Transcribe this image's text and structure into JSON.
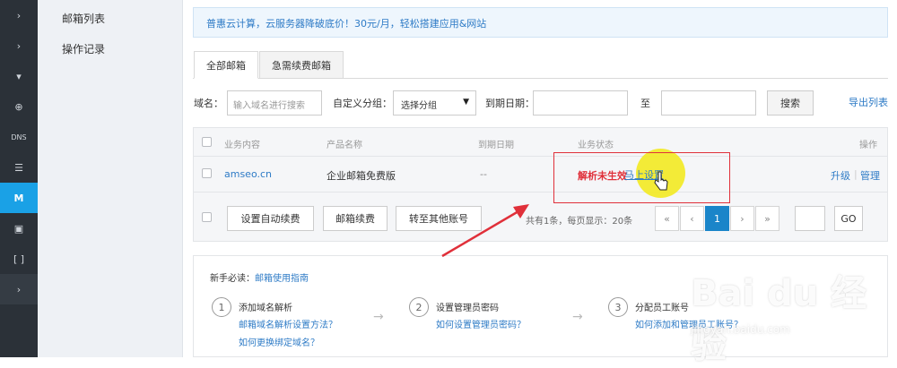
{
  "rail": {
    "items": [
      {
        "icon": "chevron-right-icon",
        "glyph": "›"
      },
      {
        "icon": "chevron-right-icon",
        "glyph": "›"
      },
      {
        "icon": "chevron-down-icon",
        "glyph": "▾"
      },
      {
        "icon": "globe-icon",
        "glyph": "⊕"
      },
      {
        "icon": "dns-icon",
        "glyph": "DNS"
      },
      {
        "icon": "server-icon",
        "glyph": "☰"
      },
      {
        "icon": "mail-m-icon",
        "glyph": "M"
      },
      {
        "icon": "mail-box-icon",
        "glyph": "▣"
      },
      {
        "icon": "cdn-icon",
        "glyph": "[ ]"
      },
      {
        "icon": "chevron-right-icon",
        "glyph": "›"
      }
    ]
  },
  "subnav": {
    "mail_list": "邮箱列表",
    "operation_log": "操作记录"
  },
  "banner": {
    "text": "普惠云计算，云服务器降破底价！30元/月，轻松搭建应用&网站"
  },
  "tabs": {
    "all": "全部邮箱",
    "renew": "急需续费邮箱"
  },
  "filter": {
    "domain_label": "域名：",
    "domain_placeholder": "输入域名进行搜索",
    "group_label": "自定义分组：",
    "group_value": "选择分组",
    "expire_label": "到期日期：",
    "to_label": "至",
    "search_button": "搜索",
    "export_link": "导出列表"
  },
  "table": {
    "headers": [
      "业务内容",
      "产品名称",
      "到期日期",
      "业务状态",
      "操作"
    ],
    "row": {
      "domain": "amseo.cn",
      "product": "企业邮箱免费版",
      "expire": "--",
      "status": "解析未生效",
      "setup_link": "马上设置",
      "upgrade": "升级",
      "sep": "|",
      "manage": "管理"
    },
    "footer": {
      "auto_renew": "设置自动续费",
      "renew": "邮箱续费",
      "transfer": "转至其他账号",
      "summary": "共有1条，每页显示：20条",
      "pages": [
        "«",
        "‹",
        "1",
        "›",
        "»"
      ],
      "go": "GO"
    }
  },
  "guide": {
    "title_prefix": "新手必读：",
    "title_link": "邮箱使用指南",
    "steps": [
      {
        "num": "1",
        "title": "添加域名解析",
        "links": [
          "邮箱域名解析设置方法？",
          "如何更换绑定域名？"
        ]
      },
      {
        "num": "2",
        "title": "设置管理员密码",
        "links": [
          "如何设置管理员密码？"
        ]
      },
      {
        "num": "3",
        "title": "分配员工账号",
        "links": [
          "如何添加和管理员工账号？"
        ]
      }
    ],
    "arrow": "→"
  },
  "watermark": {
    "big": "Bai du 经验",
    "small": "jingyan.baidu.com"
  },
  "colors": {
    "accent": "#1aa1e6",
    "link": "#2e7bc6",
    "status_red": "#e0303a",
    "highlight": "#f3ea21"
  }
}
